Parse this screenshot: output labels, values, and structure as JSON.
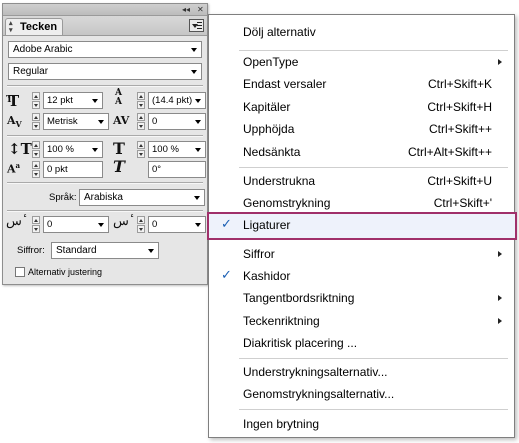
{
  "panel": {
    "tab_label": "Tecken",
    "font_family": "Adobe Arabic",
    "font_style": "Regular",
    "size": "12 pkt",
    "leading": "(14.4 pkt)",
    "kerning": "Metrisk",
    "tracking": "0",
    "vscale": "100 %",
    "hscale": "100 %",
    "baseline": "0 pkt",
    "skew": "0°",
    "language_label": "Språk:",
    "language": "Arabiska",
    "diacritic_left": "0",
    "diacritic_right": "0",
    "digits_label": "Siffror:",
    "digits": "Standard",
    "alt_justification_label": "Alternativ justering"
  },
  "menu": {
    "hide_options": "Dölj alternativ",
    "opentype": "OpenType",
    "all_caps": "Endast versaler",
    "all_caps_sc": "Ctrl+Skift+K",
    "small_caps": "Kapitäler",
    "small_caps_sc": "Ctrl+Skift+H",
    "superscript": "Upphöjda",
    "superscript_sc": "Ctrl+Skift++",
    "subscript": "Nedsänkta",
    "subscript_sc": "Ctrl+Alt+Skift++",
    "underline": "Understrukna",
    "underline_sc": "Ctrl+Skift+U",
    "strikethrough": "Genomstrykning",
    "strikethrough_sc": "Ctrl+Skift+'",
    "ligatures": "Ligaturer",
    "digits": "Siffror",
    "kashida": "Kashidor",
    "keyboard_direction": "Tangentbordsriktning",
    "character_direction": "Teckenriktning",
    "diacritic_position": "Diakritisk placering ...",
    "underline_options": "Understrykningsalternativ...",
    "strikethrough_options": "Genomstrykningsalternativ...",
    "no_break": "Ingen brytning",
    "check_glyph": "✓"
  },
  "colors": {
    "highlight_border": "#a0306a",
    "check": "#1a5fb4"
  }
}
